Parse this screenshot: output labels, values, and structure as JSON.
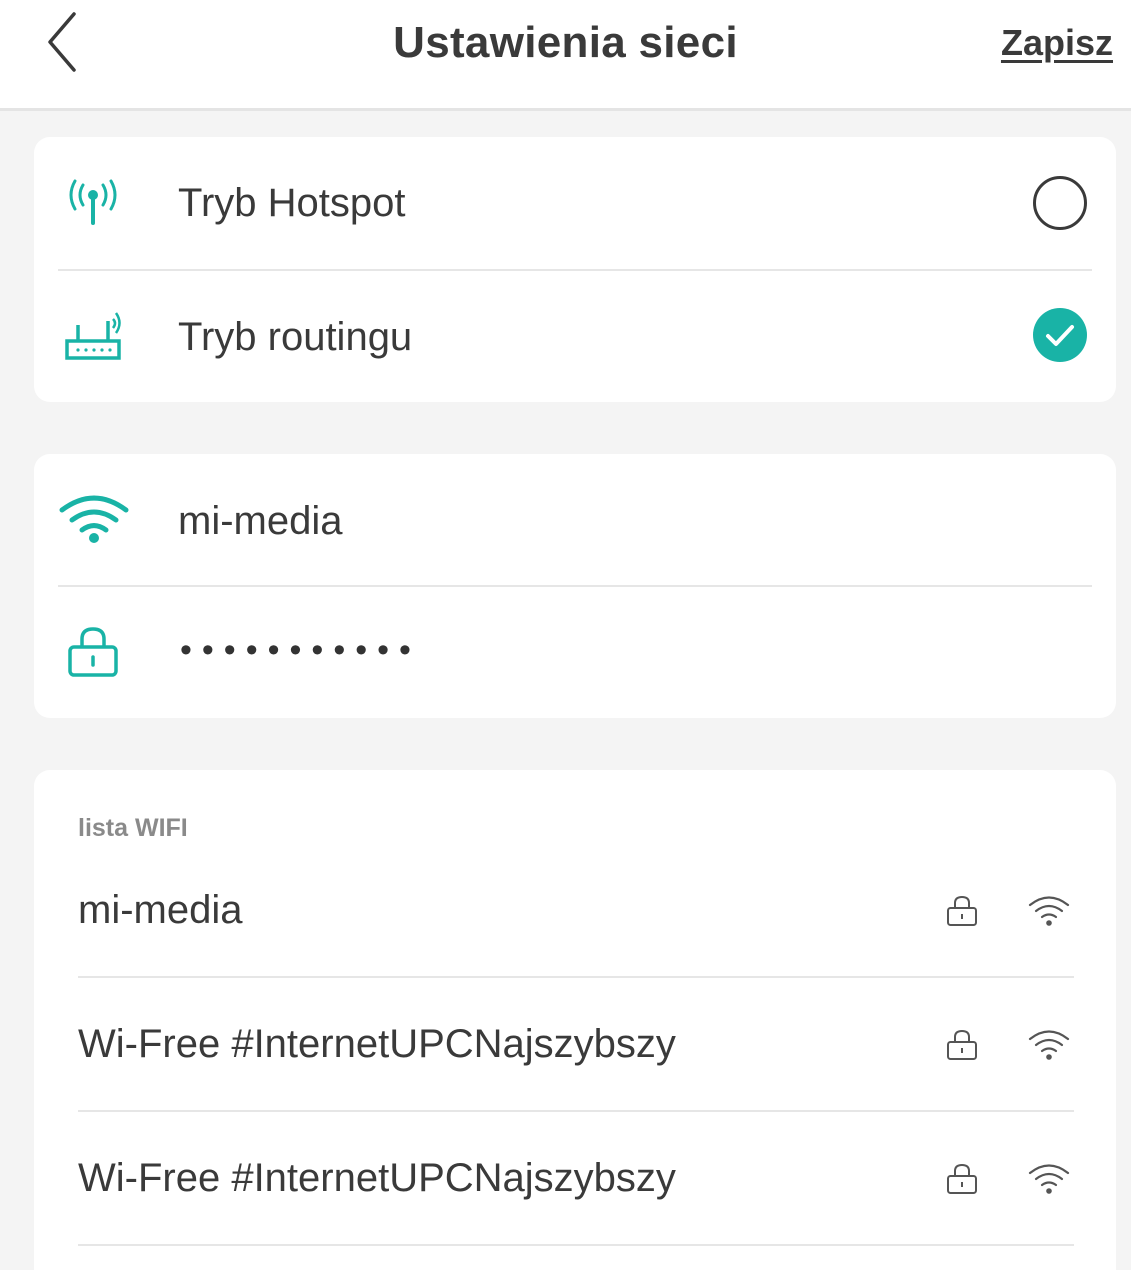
{
  "header": {
    "title": "Ustawienia sieci",
    "save_label": "Zapisz",
    "back_icon": "chevron-left-icon"
  },
  "mode": {
    "items": [
      {
        "label": "Tryb Hotspot",
        "icon": "hotspot-antenna-icon",
        "selected": false
      },
      {
        "label": "Tryb routingu",
        "icon": "router-icon",
        "selected": true
      }
    ]
  },
  "credentials": {
    "ssid": "mi-media",
    "password_masked": "•••••••••••",
    "ssid_icon": "wifi-icon",
    "password_icon": "lock-icon"
  },
  "wifi_list": {
    "title": "lista WIFI",
    "networks": [
      {
        "name": "mi-media",
        "secured": true
      },
      {
        "name": "Wi-Free #InternetUPCNajszybszy",
        "secured": true
      },
      {
        "name": "Wi-Free #InternetUPCNajszybszy",
        "secured": true
      }
    ]
  },
  "colors": {
    "accent": "#19b3a6",
    "text": "#3a3a3a",
    "background": "#f4f4f4",
    "card": "#ffffff",
    "muted": "#8a8a8a"
  }
}
